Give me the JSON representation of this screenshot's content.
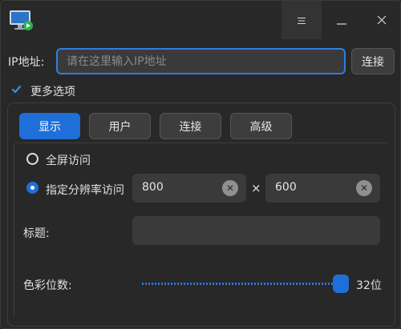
{
  "window": {
    "icons": {
      "app": "remote-desktop-monitor-icon",
      "menu": "hamburger-menu-icon",
      "minimize": "minimize-icon",
      "close": "close-icon"
    }
  },
  "connection": {
    "ip_label": "IP地址:",
    "ip_placeholder": "请在这里输入IP地址",
    "ip_value": "",
    "connect_label": "连接"
  },
  "more_options": {
    "label": "更多选项",
    "checked": true
  },
  "tabs": [
    {
      "label": "显示",
      "active": true
    },
    {
      "label": "用户",
      "active": false
    },
    {
      "label": "连接",
      "active": false
    },
    {
      "label": "高级",
      "active": false
    }
  ],
  "display": {
    "fullscreen_label": "全屏访问",
    "resolution_label": "指定分辨率访问",
    "selected_mode": "resolution",
    "width": "800",
    "height": "600",
    "times_symbol": "×",
    "title_label": "标题:",
    "title_value": "",
    "color_depth_label": "色彩位数:",
    "color_depth_value": "32位",
    "color_depth_fraction": 1.0
  },
  "colors": {
    "accent": "#1e6fd9",
    "background": "#282828",
    "field": "#3a3a3a"
  }
}
